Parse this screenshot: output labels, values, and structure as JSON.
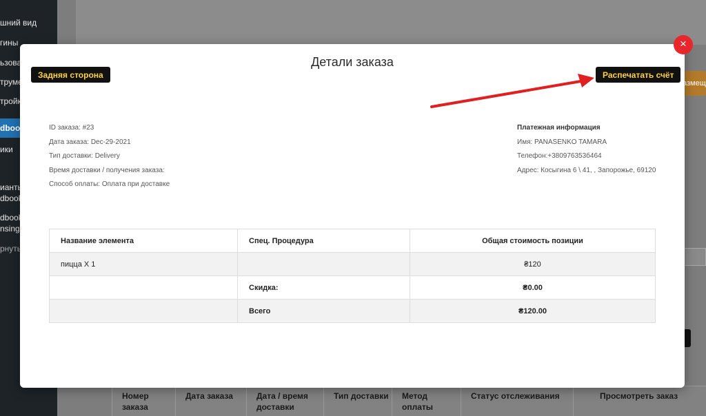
{
  "sidebar": {
    "items": [
      {
        "label": "шний вид"
      },
      {
        "label": "гины"
      },
      {
        "label": "ьзова"
      },
      {
        "label": "трумен"
      },
      {
        "label": "тройки"
      },
      {
        "label": "dbook"
      },
      {
        "label": "ики"
      },
      {
        "label": "иантьі"
      },
      {
        "label": "dbook"
      },
      {
        "label": "dbook"
      },
      {
        "label": "nsing"
      },
      {
        "label": "рнуть"
      }
    ]
  },
  "background": {
    "orange_button_label": "азмещ",
    "table_headers": [
      "Номер заказа",
      "Дата заказа",
      "Дата / время доставки",
      "Тип доставки",
      "Метод оплаты",
      "Статус отслеживания",
      "Просмотреть заказ"
    ]
  },
  "modal": {
    "title": "Детали заказа",
    "back_label": "Задняя сторона",
    "print_label": "Распечатать счёт",
    "close_glyph": "×",
    "order_info": [
      "ID заказа: #23",
      "Дата заказа: Dec-29-2021",
      "Тип доставки: Delivery",
      "Время доставки / получения заказа:",
      "Способ оплаты: Оплата при доставке"
    ],
    "payment": {
      "heading": "Платежная информация",
      "lines": [
        "Имя: PANASENKO TAMARA",
        "Телефон:+380976353б464",
        "Адрес: Косыгина 6 \\ 41, , Запорожье, 69120"
      ]
    },
    "table": {
      "headers": [
        "Название элемента",
        "Спец. Процедура",
        "Общая стоимость позиции"
      ],
      "rows": [
        [
          "пицца X 1",
          "",
          "₴120"
        ],
        [
          "",
          "Скидка:",
          "₴0.00"
        ],
        [
          "",
          "Всего",
          "₴120.00"
        ]
      ]
    }
  },
  "colors": {
    "button_bg": "#111111",
    "button_text": "#ffd23f",
    "close_bg": "#e8262c",
    "arrow": "#e02020",
    "sidebar_active": "#2271b1"
  }
}
